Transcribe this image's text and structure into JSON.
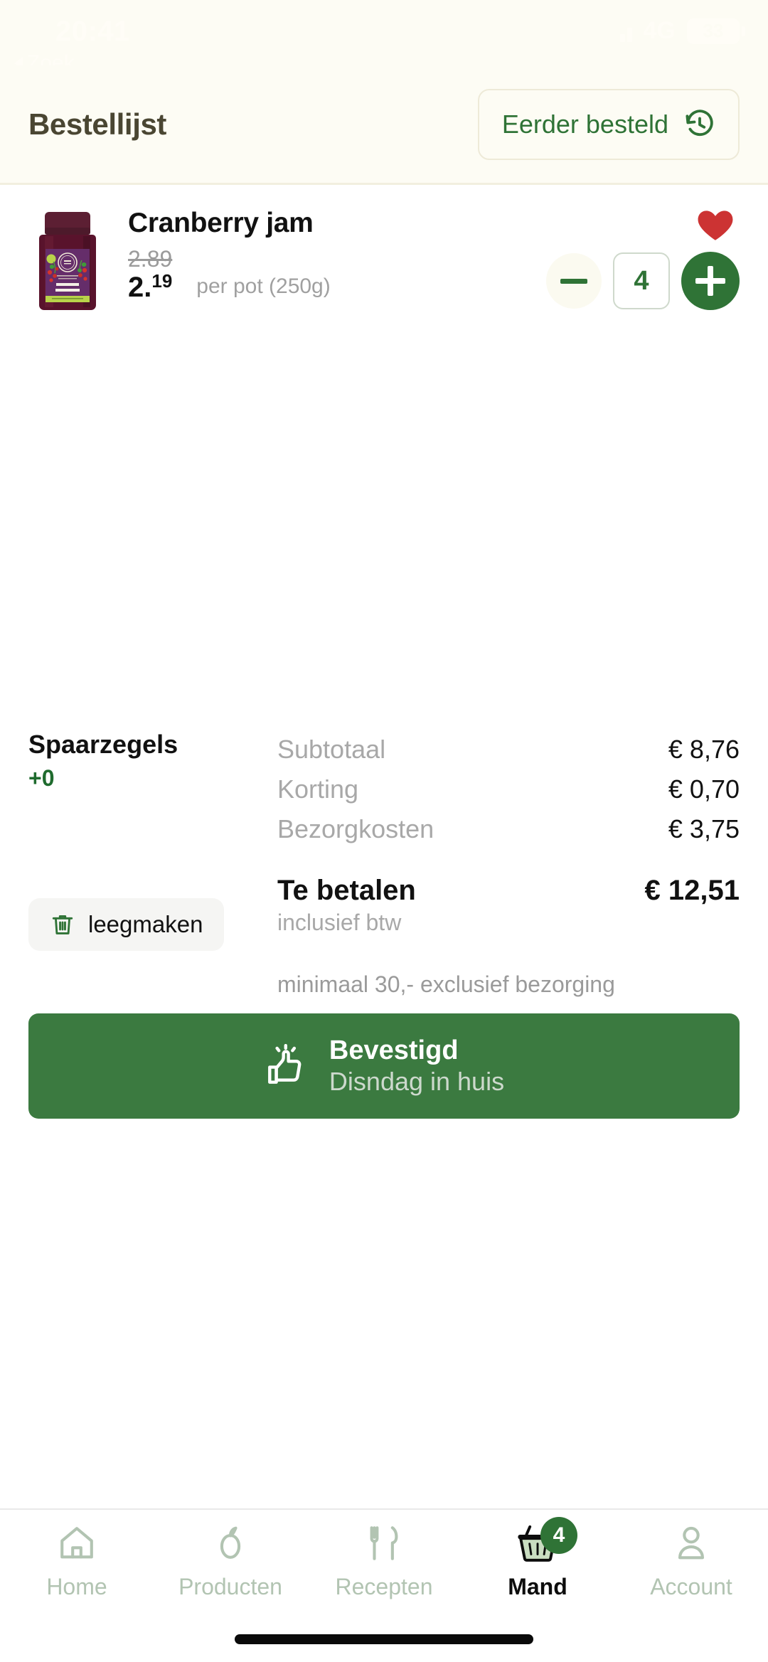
{
  "statusbar": {
    "time": "20:41",
    "back_label": "Zoek",
    "network": "4G",
    "battery": "33",
    "signal_icon": "signal-bars-icon",
    "battery_icon": "battery-icon"
  },
  "header": {
    "title": "Bestellijst",
    "prev_ordered_label": "Eerder besteld",
    "prev_ordered_icon": "history-icon",
    "background_color": "#fdfcf4",
    "accent_color": "#2f7336"
  },
  "product": {
    "name": "Cranberry jam",
    "old_price": "2.89",
    "price_whole": "2.",
    "price_cents": "19",
    "unit": "per pot (250g)",
    "quantity": "4",
    "favorite_icon": "heart-icon",
    "favorite_color": "#cc3333",
    "minus_icon": "minus-icon",
    "plus_icon": "plus-icon",
    "image_alt": "cranberry-jam-jar"
  },
  "summary": {
    "stamps_label": "Spaarzegels",
    "stamps_value": "+0",
    "empty_label": "leegmaken",
    "empty_icon": "trash-icon",
    "rows": [
      {
        "label": "Subtotaal",
        "value": "€ 8,76"
      },
      {
        "label": "Korting",
        "value": "€ 0,70"
      },
      {
        "label": "Bezorgkosten",
        "value": "€ 3,75"
      }
    ],
    "total_label": "Te betalen",
    "total_value": "€ 12,51",
    "vat_note": "inclusief btw",
    "minimum_note": "minimaal 30,- exclusief bezorging"
  },
  "confirm": {
    "main": "Bevestigd",
    "sub": "Disndag in huis",
    "icon": "thumbs-up-icon",
    "color": "#3b7a40"
  },
  "bottomnav": {
    "items": [
      {
        "label": "Home",
        "icon": "home-icon",
        "active": false
      },
      {
        "label": "Producten",
        "icon": "pear-icon",
        "active": false
      },
      {
        "label": "Recepten",
        "icon": "fork-knife-icon",
        "active": false
      },
      {
        "label": "Mand",
        "icon": "basket-icon",
        "active": true,
        "badge": "4"
      },
      {
        "label": "Account",
        "icon": "person-icon",
        "active": false
      }
    ]
  }
}
